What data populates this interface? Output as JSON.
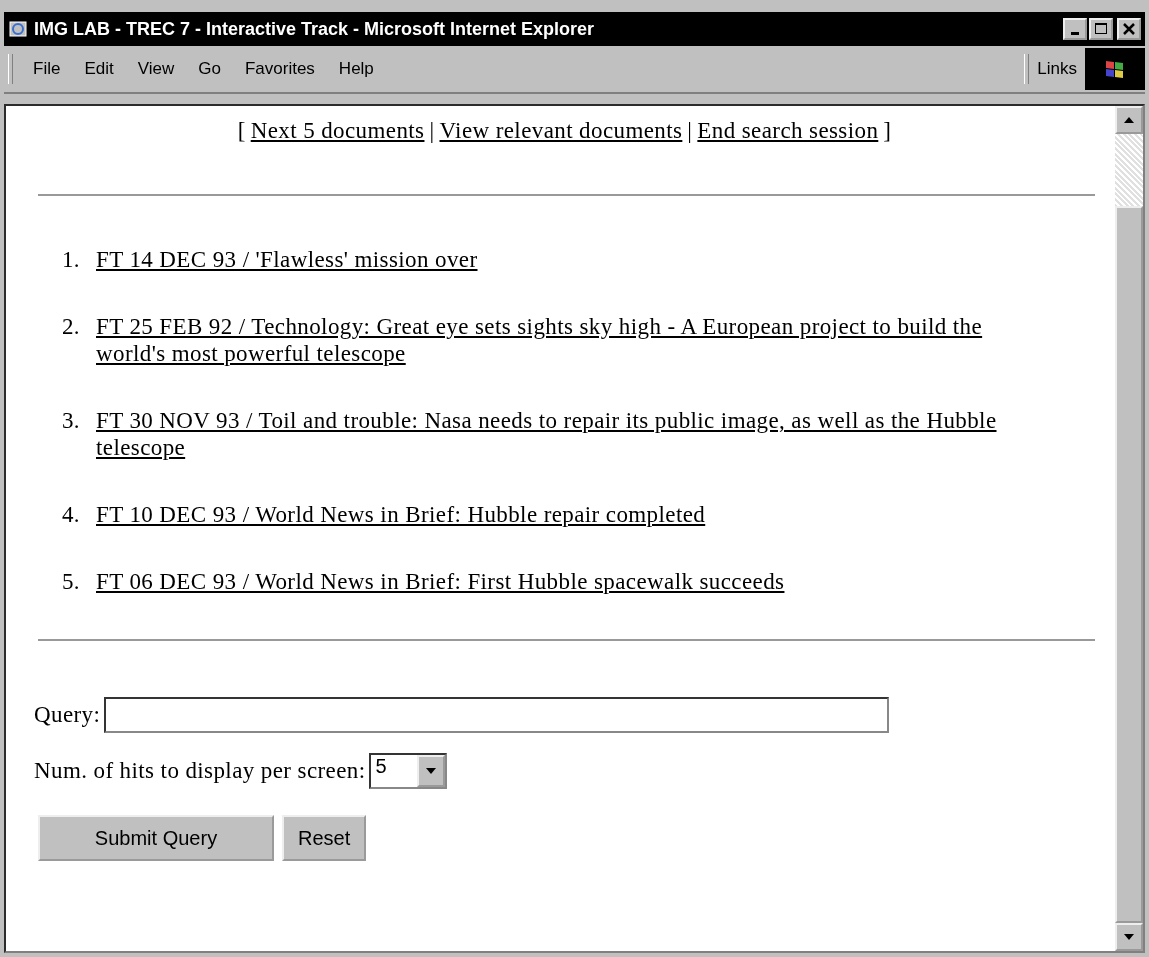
{
  "window": {
    "title": "IMG LAB - TREC 7 - Interactive Track - Microsoft Internet Explorer"
  },
  "menu": [
    "File",
    "Edit",
    "View",
    "Go",
    "Favorites",
    "Help"
  ],
  "links_toolbar": {
    "label": "Links"
  },
  "nav": {
    "open": "[",
    "separator": "|",
    "close": "]",
    "links": [
      "Next 5 documents",
      "View relevant documents",
      "End search session"
    ]
  },
  "results": [
    {
      "number": "1.",
      "title": "FT 14 DEC 93 / 'Flawless' mission over"
    },
    {
      "number": "2.",
      "title": "FT 25 FEB 92 / Technology: Great eye sets sights sky high - A European project to build the world's most powerful telescope"
    },
    {
      "number": "3.",
      "title": "FT 30 NOV 93 / Toil and trouble: Nasa needs to repair its public image, as well as the Hubble telescope"
    },
    {
      "number": "4.",
      "title": "FT 10 DEC 93 / World News in Brief: Hubble repair completed"
    },
    {
      "number": "5.",
      "title": "FT 06 DEC 93 / World News in Brief: First Hubble spacewalk succeeds"
    }
  ],
  "form": {
    "query_label": "Query:",
    "hits_label": "Num. of hits to display per screen:",
    "hits_value": "5",
    "buttons": [
      "Submit Query",
      "Reset"
    ]
  }
}
